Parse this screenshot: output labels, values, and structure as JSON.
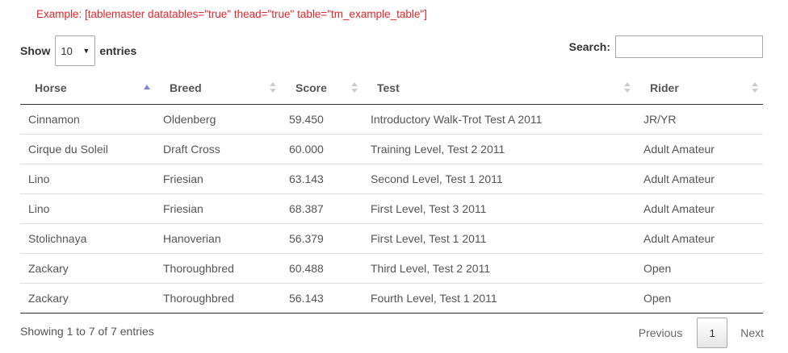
{
  "example_note": "Example: [tablemaster datatables=\"true\" thead=\"true\" table=\"tm_example_table\"]",
  "length": {
    "show_label": "Show",
    "selected": "10",
    "entries_label": "entries"
  },
  "search": {
    "label": "Search:",
    "value": ""
  },
  "table": {
    "columns": [
      "Horse",
      "Breed",
      "Score",
      "Test",
      "Rider"
    ],
    "sorted_column": "Horse",
    "sort_direction": "ascending",
    "rows": [
      [
        "Cinnamon",
        "Oldenberg",
        "59.450",
        "Introductory Walk-Trot Test A 2011",
        "JR/YR"
      ],
      [
        "Cirque du Soleil",
        "Draft Cross",
        "60.000",
        "Training Level, Test 2 2011",
        "Adult Amateur"
      ],
      [
        "Lino",
        "Friesian",
        "63.143",
        "Second Level, Test 1 2011",
        "Adult Amateur"
      ],
      [
        "Lino",
        "Friesian",
        "68.387",
        "First Level, Test 3 2011",
        "Adult Amateur"
      ],
      [
        "Stolichnaya",
        "Hanoverian",
        "56.379",
        "First Level, Test 1 2011",
        "Adult Amateur"
      ],
      [
        "Zackary",
        "Thoroughbred",
        "60.488",
        "Third Level, Test 2 2011",
        "Open"
      ],
      [
        "Zackary",
        "Thoroughbred",
        "56.143",
        "Fourth Level, Test 1 2011",
        "Open"
      ]
    ]
  },
  "info": "Showing 1 to 7 of 7 entries",
  "pagination": {
    "previous": "Previous",
    "current_page": "1",
    "next": "Next"
  },
  "colors": {
    "note": "#e3262a",
    "sort_active": "#7b8ad6",
    "sort_inactive": "#cccccc"
  }
}
